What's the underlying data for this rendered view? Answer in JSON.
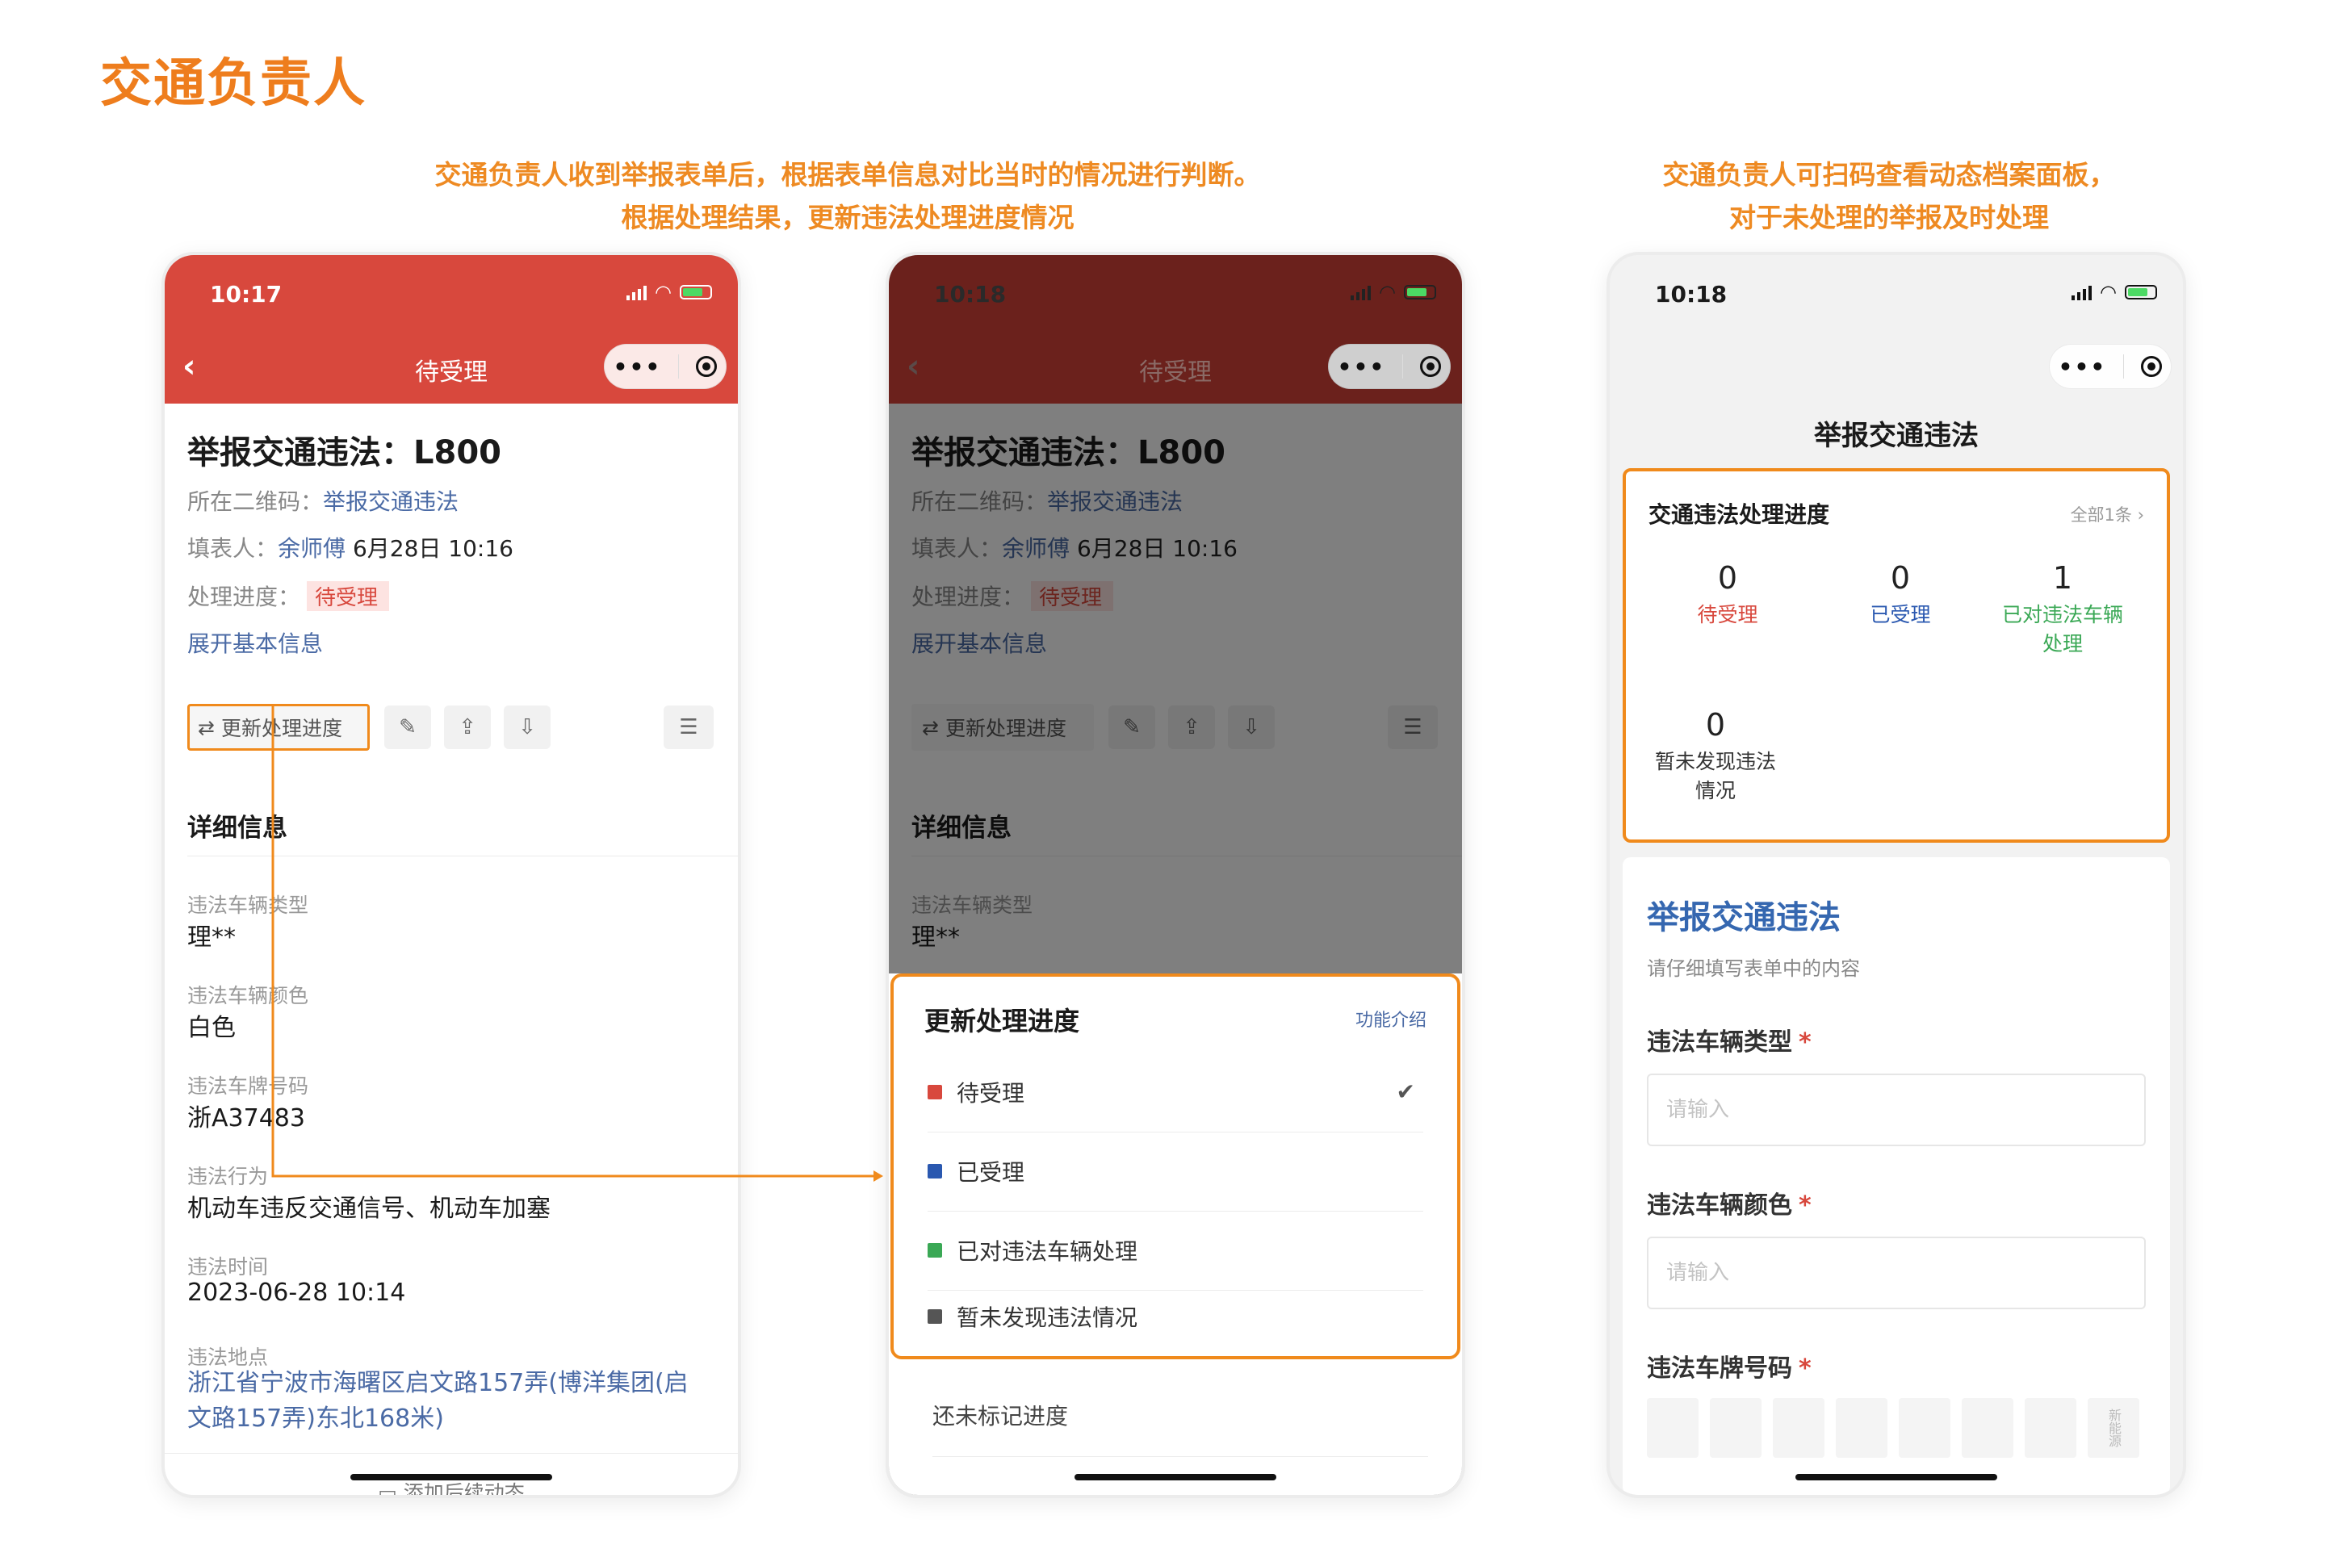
{
  "page_title": "交通负责人",
  "captions": {
    "left_line1": "交通负责人收到举报表单后，根据表单信息对比当时的情况进行判断。",
    "left_line2": "根据处理结果，更新违法处理进度情况",
    "right_line1": "交通负责人可扫码查看动态档案面板，",
    "right_line2": "对于未处理的举报及时处理"
  },
  "colors": {
    "accent_orange": "#f08a1c",
    "header_red": "#d8483d",
    "link_blue": "#4a6aa5",
    "status_pending": "#d8483d",
    "status_accepted": "#2a58b0",
    "status_handled": "#3aa855",
    "status_none": "#555555"
  },
  "phone1": {
    "time": "10:17",
    "nav_title": "待受理",
    "title": "举报交通违法：L800",
    "qr_label": "所在二维码：",
    "qr_value": "举报交通违法",
    "filler_label": "填表人：",
    "filler_name": "余师傅",
    "filler_time": "6月28日 10:16",
    "progress_label": "处理进度：",
    "progress_tag": "待受理",
    "expand_text": "展开基本信息",
    "update_btn": "更新处理进度",
    "section_title": "详细信息",
    "fields": [
      {
        "label": "违法车辆类型",
        "value": "理**"
      },
      {
        "label": "违法车辆颜色",
        "value": "白色"
      },
      {
        "label": "违法车牌号码",
        "value": "浙A37483"
      },
      {
        "label": "违法行为",
        "value": "机动车违反交通信号、机动车加塞"
      },
      {
        "label": "违法时间",
        "value": "2023-06-28 10:14"
      },
      {
        "label": "违法地点",
        "value": "浙江省宁波市海曙区启文路157弄(博洋集团(启文路157弄)东北168米)"
      }
    ],
    "add_followup": "添加后续动态"
  },
  "phone2": {
    "time": "10:18",
    "nav_title": "待受理",
    "sheet_title": "更新处理进度",
    "sheet_link": "功能介绍",
    "options": [
      {
        "label": "待受理",
        "color": "#d8483d",
        "checked": true
      },
      {
        "label": "已受理",
        "color": "#2a58b0",
        "checked": false
      },
      {
        "label": "已对违法车辆处理",
        "color": "#3aa855",
        "checked": false
      },
      {
        "label": "暂未发现违法情况",
        "color": "#555555",
        "checked": false
      }
    ],
    "unmarked": "还未标记进度"
  },
  "phone3": {
    "time": "10:18",
    "page_title": "举报交通违法",
    "card_title": "交通违法处理进度",
    "card_all": "全部1条 ›",
    "stats": [
      {
        "num": "0",
        "label": "待受理",
        "color": "#d8483d"
      },
      {
        "num": "0",
        "label": "已受理",
        "color": "#2a58b0"
      },
      {
        "num": "1",
        "label": "已对违法车辆处理",
        "color": "#3aa855"
      },
      {
        "num": "0",
        "label": "暂未发现违法情况",
        "color": "#333333"
      }
    ],
    "form_title": "举报交通违法",
    "form_sub": "请仔细填写表单中的内容",
    "q1_label": "违法车辆类型",
    "q2_label": "违法车辆颜色",
    "q3_label": "违法车牌号码",
    "required_mark": "*",
    "input_placeholder": "请输入",
    "plate_new_energy": "新能源"
  }
}
